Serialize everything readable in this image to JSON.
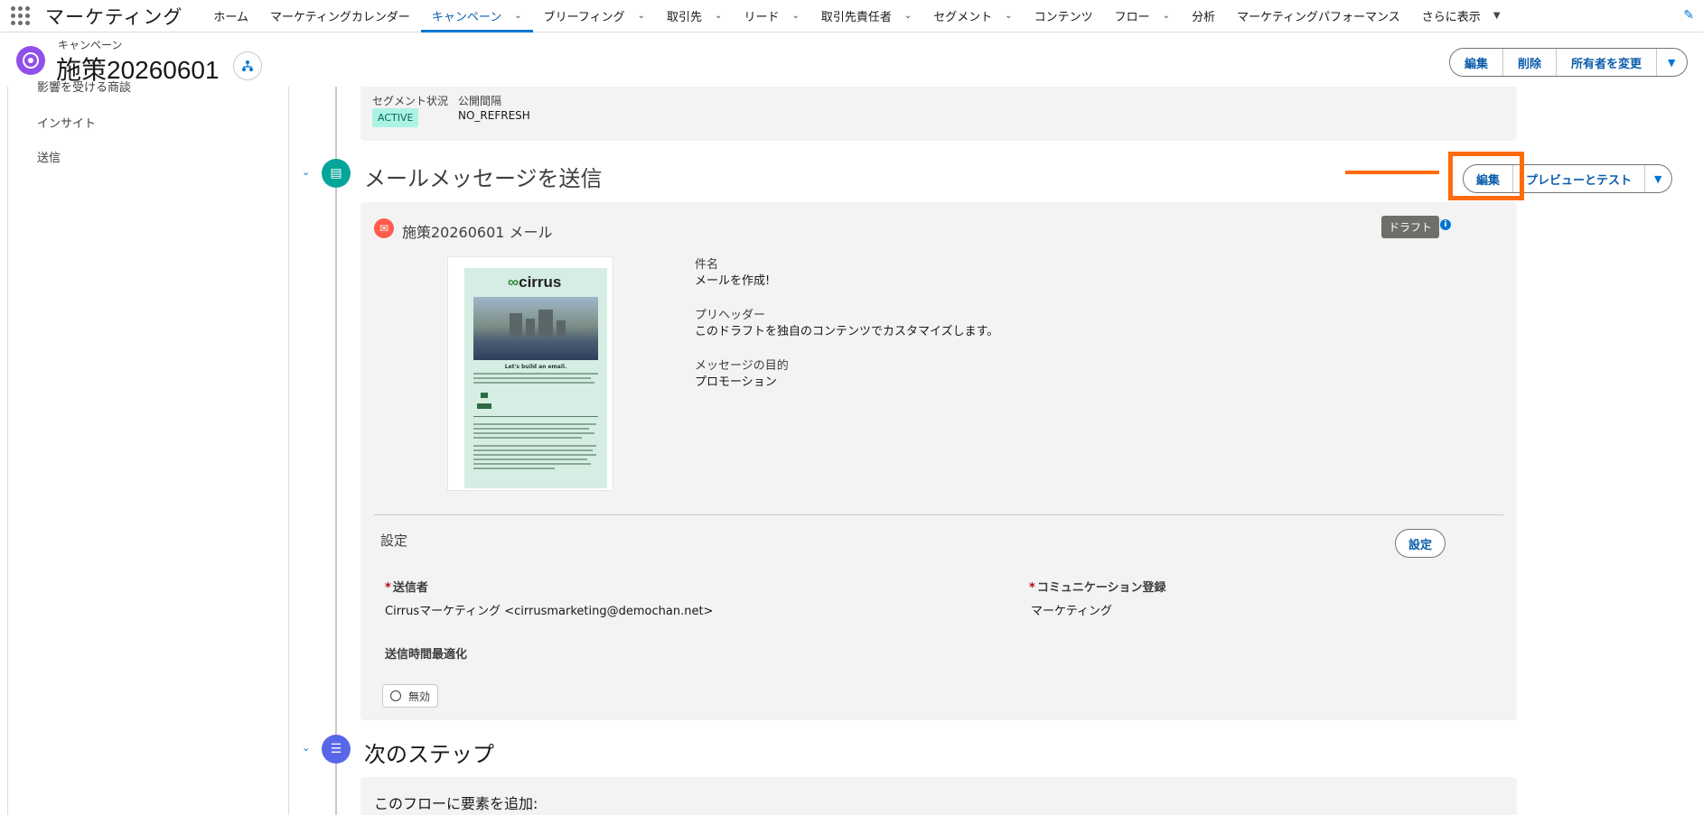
{
  "app": {
    "name": "マーケティング"
  },
  "nav": {
    "items": [
      {
        "label": "ホーム",
        "dropdown": false,
        "active": false
      },
      {
        "label": "マーケティングカレンダー",
        "dropdown": false,
        "active": false
      },
      {
        "label": "キャンペーン",
        "dropdown": true,
        "active": true
      },
      {
        "label": "ブリーフィング",
        "dropdown": true,
        "active": false
      },
      {
        "label": "取引先",
        "dropdown": true,
        "active": false
      },
      {
        "label": "リード",
        "dropdown": true,
        "active": false
      },
      {
        "label": "取引先責任者",
        "dropdown": true,
        "active": false
      },
      {
        "label": "セグメント",
        "dropdown": true,
        "active": false
      },
      {
        "label": "コンテンツ",
        "dropdown": false,
        "active": false
      },
      {
        "label": "フロー",
        "dropdown": true,
        "active": false
      },
      {
        "label": "分析",
        "dropdown": false,
        "active": false
      },
      {
        "label": "マーケティングパフォーマンス",
        "dropdown": false,
        "active": false
      },
      {
        "label": "さらに表示",
        "dropdown": true,
        "active": false
      }
    ]
  },
  "record": {
    "object_label": "キャンペーン",
    "title": "施策20260601",
    "actions": {
      "edit": "編集",
      "delete": "削除",
      "change_owner": "所有者を変更"
    }
  },
  "sidebar": {
    "items": [
      "影響を受ける商談",
      "インサイト",
      "送信"
    ]
  },
  "segment": {
    "status_label": "セグメント状況",
    "status_value": "ACTIVE",
    "publish_label": "公開間隔",
    "publish_value": "NO_REFRESH"
  },
  "email_section": {
    "title": "メールメッセージを送信",
    "edit_label": "編集",
    "preview_label": "プレビューとテスト",
    "email_name": "施策20260601 メール",
    "status_badge": "ドラフト",
    "thumbnail": {
      "logo_text": "cirrus",
      "headline": "Let's build an email."
    },
    "fields": [
      {
        "label": "件名",
        "value": "メールを作成!"
      },
      {
        "label": "プリヘッダー",
        "value": "このドラフトを独自のコンテンツでカスタマイズします。"
      },
      {
        "label": "メッセージの目的",
        "value": "プロモーション"
      }
    ],
    "settings": {
      "title": "設定",
      "button": "設定",
      "sender_label": "送信者",
      "sender_value": "Cirrusマーケティング <cirrusmarketing@demochan.net>",
      "subscription_label": "コミュニケーション登録",
      "subscription_value": "マーケティング",
      "send_time_label": "送信時間最適化",
      "send_time_value": "無効"
    }
  },
  "next_section": {
    "title": "次のステップ",
    "add_label": "このフローに要素を追加:"
  },
  "colors": {
    "accent": "#0176d3",
    "campaign_icon": "#9050e9",
    "section_icon": "#06a59a",
    "next_icon": "#5867e8",
    "highlight": "#ff6a0c",
    "active_badge": "#acf3e4"
  }
}
